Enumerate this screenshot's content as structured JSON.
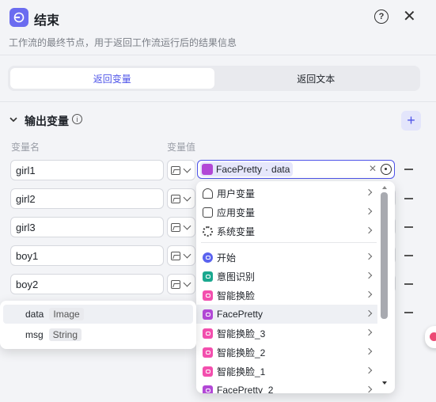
{
  "header": {
    "title": "结束",
    "description": "工作流的最终节点，用于返回工作流运行后的结果信息",
    "accent": "#6b6cf0"
  },
  "tabs": [
    {
      "label": "返回变量",
      "active": true
    },
    {
      "label": "返回文本",
      "active": false
    }
  ],
  "section": {
    "title": "输出变量",
    "col_name": "变量名",
    "col_value": "变量值"
  },
  "rows": [
    {
      "name": "girl1"
    },
    {
      "name": "girl2"
    },
    {
      "name": "girl3"
    },
    {
      "name": "boy1"
    },
    {
      "name": "boy2"
    }
  ],
  "value_ref": {
    "source": "FacePretty",
    "separator": " - ",
    "field": "data"
  },
  "dropdown": {
    "groups": [
      {
        "label": "用户变量",
        "icon": "user-icon"
      },
      {
        "label": "应用变量",
        "icon": "folder-icon"
      },
      {
        "label": "系统变量",
        "icon": "gear-icon"
      }
    ],
    "nodes": [
      {
        "label": "开始",
        "icon": "start-node-icon",
        "color": "#5a63ef"
      },
      {
        "label": "意图识别",
        "icon": "intent-node-icon",
        "color": "#1aa88f"
      },
      {
        "label": "智能换脸",
        "icon": "face-swap-node-icon",
        "color": "#f34fae"
      },
      {
        "label": "FacePretty",
        "icon": "face-pretty-node-icon",
        "color": "#b248d6"
      },
      {
        "label": "智能换脸_3",
        "icon": "face-swap-node-icon",
        "color": "#f34fae"
      },
      {
        "label": "智能换脸_2",
        "icon": "face-swap-node-icon",
        "color": "#f34fae"
      },
      {
        "label": "智能换脸_1",
        "icon": "face-swap-node-icon",
        "color": "#f34fae"
      },
      {
        "label": "FacePretty_2",
        "icon": "face-pretty-node-icon",
        "color": "#b248d6"
      }
    ]
  },
  "subpopover": {
    "items": [
      {
        "name": "data",
        "type": "Image"
      },
      {
        "name": "msg",
        "type": "String"
      }
    ]
  }
}
